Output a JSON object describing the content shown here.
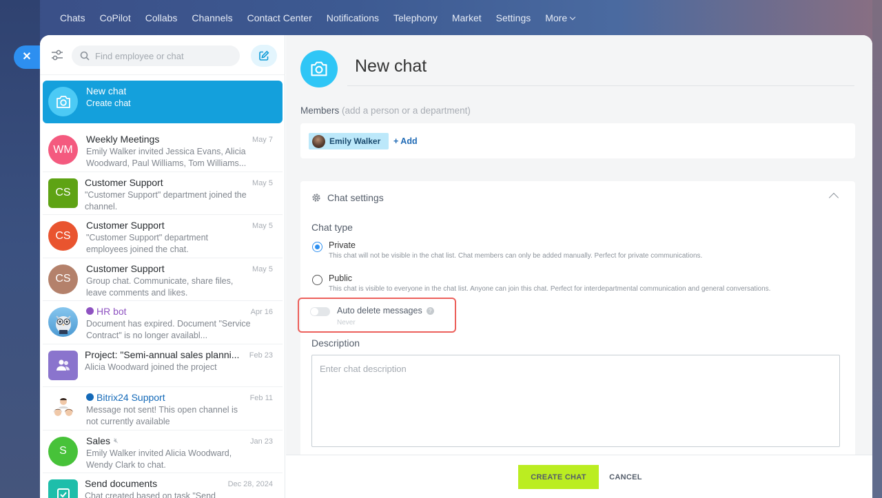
{
  "topnav": {
    "items": [
      "Chats",
      "CoPilot",
      "Collabs",
      "Channels",
      "Contact Center",
      "Notifications",
      "Telephony",
      "Market",
      "Settings",
      "More"
    ]
  },
  "sidebar": {
    "search_placeholder": "Find employee or chat",
    "chats": [
      {
        "title": "New chat",
        "preview": "Create chat",
        "date": "",
        "avatar": "camera-icon",
        "color": "#2fc6f6",
        "active": true
      },
      {
        "title": "Weekly Meetings",
        "preview": "Emily Walker invited Jessica Evans, Alicia Woodward, Paul Williams, Tom Williams...",
        "date": "May 7",
        "initials": "WM",
        "color": "#f45a7f"
      },
      {
        "title": "Customer Support",
        "preview": "\"Customer Support\" department joined the channel.",
        "date": "May 5",
        "initials": "CS",
        "color": "#5ea314"
      },
      {
        "title": "Customer Support",
        "preview": "\"Customer Support\" department employees joined the chat.",
        "date": "May 5",
        "initials": "CS",
        "color": "#e9542f"
      },
      {
        "title": "Customer Support",
        "preview": "Group chat. Communicate, share files, leave comments and likes.",
        "date": "May 5",
        "initials": "CS",
        "color": "#b4816b"
      },
      {
        "title": "HR bot",
        "preview": "Document has expired. Document \"Service Contract\" is no longer availabl...",
        "date": "Apr 16",
        "avatar": "owl-bot-icon"
      },
      {
        "title": "Project: \"Semi-annual sales planni...",
        "preview": "Alicia Woodward joined the project",
        "date": "Feb 23",
        "avatar": "group-icon",
        "color": "#8a74cd"
      },
      {
        "title": "Bitrix24 Support",
        "preview": "Message not sent! This open channel is not currently available",
        "date": "Feb 11",
        "avatar": "support-people-icon"
      },
      {
        "title": "Sales",
        "preview": "Emily Walker invited Alicia Woodward, Wendy Clark to chat.",
        "date": "Jan 23",
        "initials": "S",
        "color": "#47c239"
      },
      {
        "title": "Send documents",
        "preview": "Chat created based on task \"Send",
        "date": "Dec 28, 2024",
        "avatar": "task-check-icon",
        "color": "#1ebeaa"
      }
    ]
  },
  "main": {
    "title_value": "New chat",
    "members_label": "Members",
    "members_hint": "(add a person or a department)",
    "member": "Emily Walker",
    "add_label": "+ Add",
    "settings_title": "Chat settings",
    "chat_type_label": "Chat type",
    "private_title": "Private",
    "private_desc": "This chat will not be visible in the chat list. Chat members can only be added manually. Perfect for private communications.",
    "public_title": "Public",
    "public_desc": "This chat is visible to everyone in the chat list. Anyone can join this chat. Perfect for interdepartmental communication and general conversations.",
    "auto_delete_label": "Auto delete messages",
    "auto_delete_value": "Never",
    "description_label": "Description",
    "description_placeholder": "Enter chat description",
    "create_button": "CREATE CHAT",
    "cancel_button": "CANCEL"
  },
  "colors": {
    "accent": "#2fc6f6",
    "active_item": "#14a0dc",
    "create_button": "#bbed21",
    "highlight_border": "#ec5f5a"
  }
}
